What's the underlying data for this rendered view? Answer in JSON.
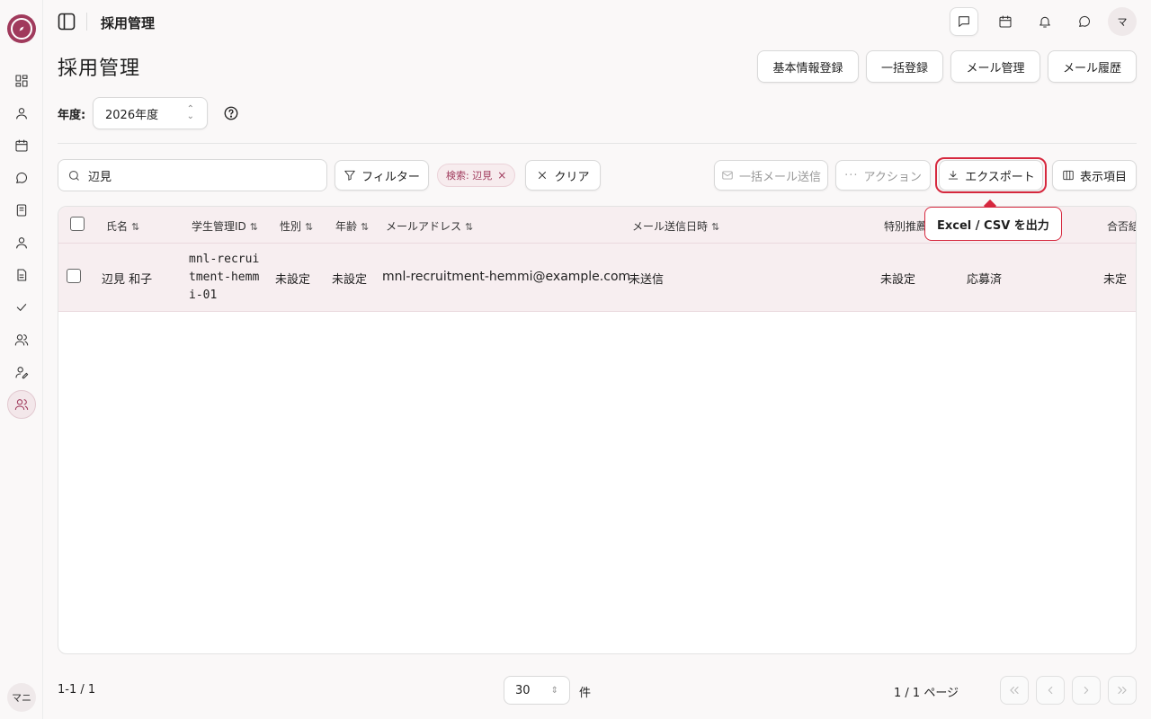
{
  "header": {
    "title": "採用管理",
    "avatar_initial": "マ"
  },
  "page": {
    "title": "採用管理"
  },
  "actions": {
    "basic_info": "基本情報登録",
    "bulk_register": "一括登録",
    "mail_manage": "メール管理",
    "mail_history": "メール履歴"
  },
  "year": {
    "label": "年度:",
    "value": "2026年度"
  },
  "toolbar": {
    "search_value": "辺見",
    "filter": "フィルター",
    "chip": "検索: 辺見",
    "clear": "クリア",
    "bulk_mail": "一括メール送信",
    "action": "アクション",
    "export": "エクスポート",
    "columns": "表示項目",
    "export_tooltip": "Excel / CSV を出力"
  },
  "table": {
    "headers": [
      "氏名",
      "学生管理ID",
      "性別",
      "年齢",
      "メールアドレス",
      "メール送信日時",
      "特別推薦",
      "合否結"
    ],
    "rows": [
      {
        "name": "辺見 和子",
        "student_id": "mnl-recruitment-hemmi-01",
        "gender": "未設定",
        "age": "未設定",
        "email": "mnl-recruitment-hemmi@example.com",
        "mail_sent": "未送信",
        "special": "未設定",
        "status": "応募済",
        "result": "未定"
      }
    ]
  },
  "footer": {
    "range": "1-1 / 1",
    "per_page": "30",
    "per_unit": "件",
    "page_info": "1 / 1 ページ"
  },
  "sidebar": {
    "user_initial": "マニ"
  },
  "colors": {
    "accent": "#a03a5c",
    "highlight": "#d6283e"
  }
}
